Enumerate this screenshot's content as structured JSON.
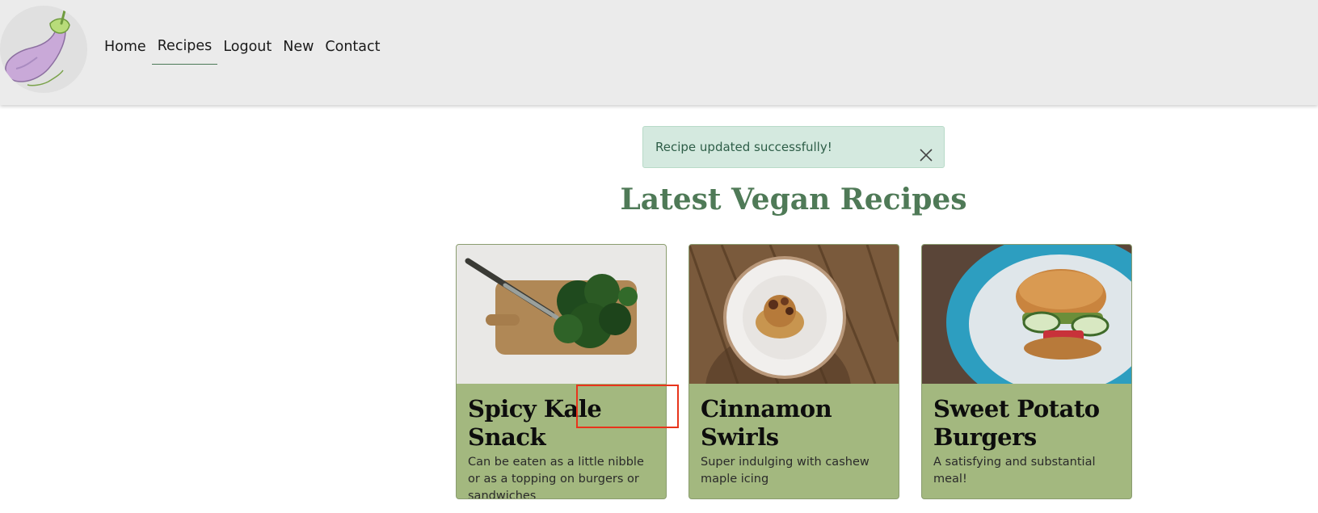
{
  "nav": {
    "items": [
      {
        "label": "Home",
        "active": false
      },
      {
        "label": "Recipes",
        "active": true
      },
      {
        "label": "Logout",
        "active": false
      },
      {
        "label": "New",
        "active": false
      },
      {
        "label": "Contact",
        "active": false
      }
    ]
  },
  "alert": {
    "message": "Recipe updated successfully!"
  },
  "main": {
    "title": "Latest Vegan Recipes"
  },
  "recipes": [
    {
      "title": "Spicy Kale Snack",
      "description": "Can be eaten as a little nibble or as a topping on burgers or sandwiches"
    },
    {
      "title": "Cinnamon Swirls",
      "description": "Super indulging with cashew maple icing"
    },
    {
      "title": "Sweet Potato Burgers",
      "description": "A satisfying and substantial meal!"
    }
  ],
  "colors": {
    "brand_green": "#4f7a57",
    "card_green": "#a3b87f",
    "alert_bg": "#d4e9df",
    "highlight": "#e8341c"
  }
}
